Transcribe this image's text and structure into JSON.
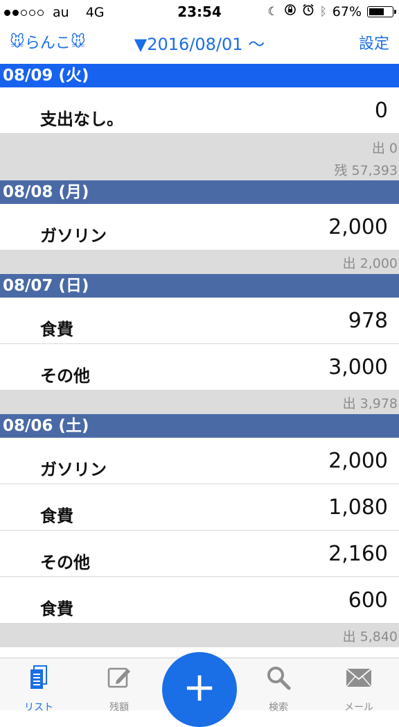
{
  "status": {
    "carrier": "au",
    "network": "4G",
    "time": "23:54",
    "battery": "67%",
    "battery_level": 0.67,
    "icons": [
      "moon-icon",
      "orientation-lock-icon",
      "alarm-icon",
      "bluetooth-icon"
    ]
  },
  "nav": {
    "title": "らんこ",
    "date_range": "▼2016/08/01 〜",
    "settings_label": "設定",
    "accent_color": "#1a6ee6"
  },
  "days": [
    {
      "header": "08/09 (火)",
      "selected": true,
      "entries": [
        {
          "category": "支出なし。",
          "amount": "0"
        }
      ],
      "summary": {
        "expense": "出 0",
        "balance": "残 57,393"
      }
    },
    {
      "header": "08/08 (月)",
      "entries": [
        {
          "category": "ガソリン",
          "amount": "2,000"
        }
      ],
      "summary": {
        "expense": "出 2,000"
      }
    },
    {
      "header": "08/07 (日)",
      "entries": [
        {
          "category": "食費",
          "amount": "978"
        },
        {
          "category": "その他",
          "amount": "3,000"
        }
      ],
      "summary": {
        "expense": "出 3,978"
      }
    },
    {
      "header": "08/06 (土)",
      "entries": [
        {
          "category": "ガソリン",
          "amount": "2,000"
        },
        {
          "category": "食費",
          "amount": "1,080"
        },
        {
          "category": "その他",
          "amount": "2,160"
        },
        {
          "category": "食費",
          "amount": "600"
        }
      ],
      "summary": {
        "expense": "出 5,840"
      }
    }
  ],
  "tabs": {
    "list": "リスト",
    "balance": "残額",
    "add": "+",
    "search": "検索",
    "mail": "メール"
  }
}
